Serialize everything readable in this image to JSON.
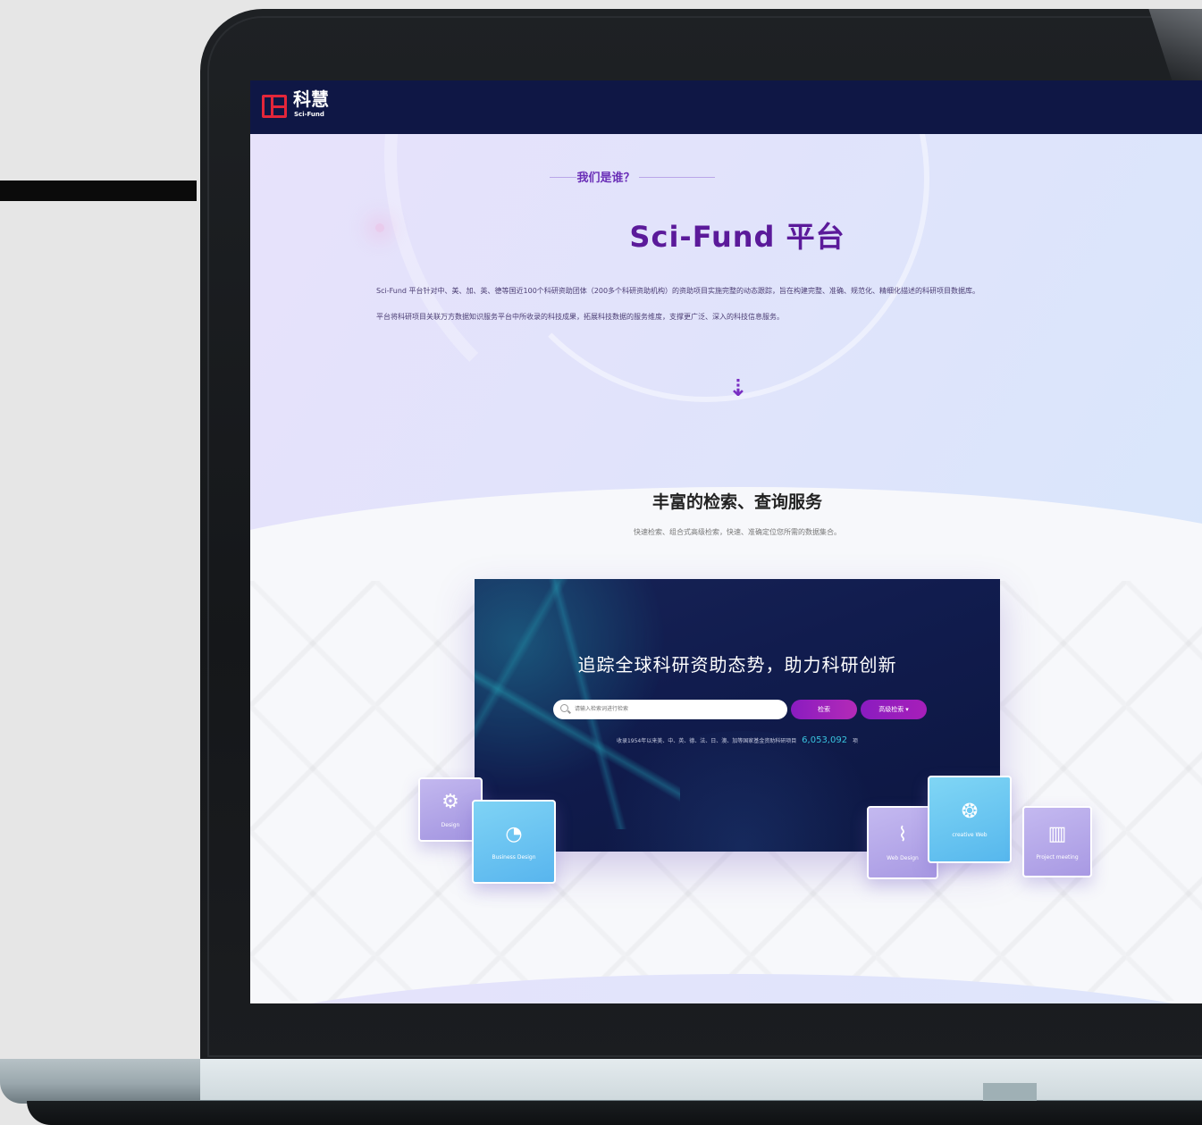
{
  "brand": {
    "name": "科慧",
    "sub": "Sci-Fund",
    "accent": "#e3263a",
    "nav_color": "#0f1745"
  },
  "hero": {
    "eyebrow": "我们是谁？",
    "title": "Sci-Fund 平台",
    "desc_line1": "Sci-Fund 平台针对中、美、加、英、德等国近100个科研资助团体（200多个科研资助机构）的资助项目实施完整的动态跟踪，旨在构建完整、准确、规范化、精细化描述的科研项目数据库。",
    "desc_line2": "平台将科研项目关联万方数据知识服务平台中所收录的科技成果，拓展科技数据的服务维度，支撑更广泛、深入的科技信息服务。",
    "arrow": "⇣",
    "title_color": "#5b1a9a"
  },
  "service": {
    "title": "丰富的检索、查询服务",
    "subtitle": "快速检索、组合式高级检索，快速、准确定位您所需的数据集合。"
  },
  "panel": {
    "title": "追踪全球科研资助态势，助力科研创新",
    "search_placeholder": "请输入检索词进行检索",
    "search_button": "检索",
    "advanced_button": "高级检索 ▾",
    "stats_text": "收录1954年以来美、中、英、德、法、日、澳、加等国家基金资助科研项目",
    "stats_number": "6,053,092",
    "stats_unit": "项"
  },
  "cards": {
    "design": {
      "label": "Design",
      "icon": "gear-icon"
    },
    "business": {
      "label": "Business Design",
      "icon": "pie-chart-icon"
    },
    "web": {
      "label": "Web Design",
      "icon": "paperclip-icon"
    },
    "creative": {
      "label": "creative Web",
      "icon": "head-gear-icon"
    },
    "project": {
      "label": "Project meeting",
      "icon": "bar-chart-icon"
    }
  }
}
